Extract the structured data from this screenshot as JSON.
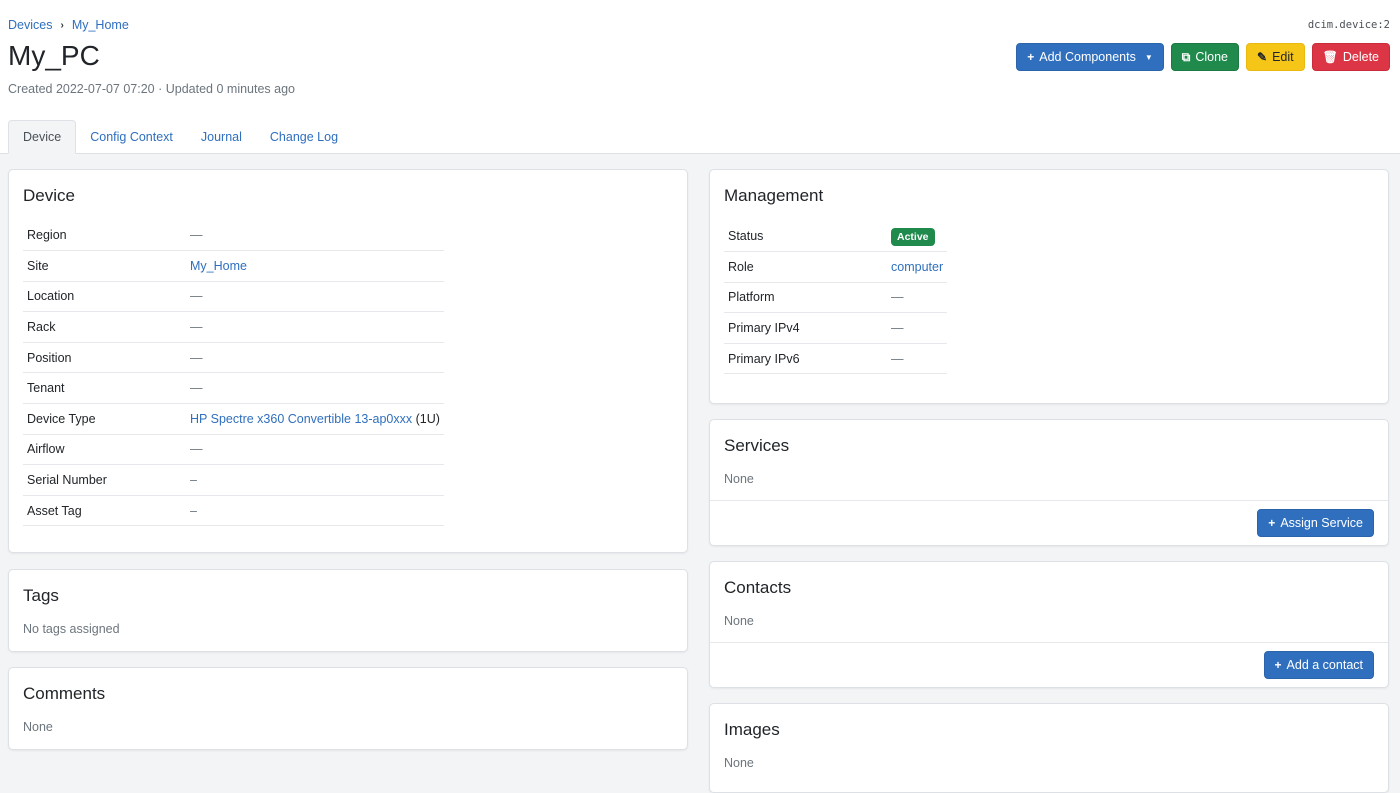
{
  "breadcrumb": {
    "root": "Devices",
    "site": "My_Home"
  },
  "object_id": "dcim.device:2",
  "title": "My_PC",
  "meta": "Created 2022-07-07 07:20 · Updated 0 minutes ago",
  "actions": {
    "add_components": "Add Components",
    "clone": "Clone",
    "edit": "Edit",
    "delete": "Delete"
  },
  "tabs": [
    "Device",
    "Config Context",
    "Journal",
    "Change Log"
  ],
  "device_card": {
    "title": "Device",
    "rows": [
      {
        "key": "Region",
        "value": "—"
      },
      {
        "key": "Site",
        "value": "My_Home"
      },
      {
        "key": "Location",
        "value": "—"
      },
      {
        "key": "Rack",
        "value": "—"
      },
      {
        "key": "Position",
        "value": "—"
      },
      {
        "key": "Tenant",
        "value": "—"
      },
      {
        "key": "Device Type",
        "value": "HP Spectre x360 Convertible 13-ap0xxx",
        "suffix": "(1U)"
      },
      {
        "key": "Airflow",
        "value": "—"
      },
      {
        "key": "Serial Number",
        "value": "–"
      },
      {
        "key": "Asset Tag",
        "value": "–"
      }
    ]
  },
  "tags_card": {
    "title": "Tags",
    "text": "No tags assigned"
  },
  "comments_card": {
    "title": "Comments",
    "text": "None"
  },
  "management_card": {
    "title": "Management",
    "rows": [
      {
        "key": "Status",
        "value": "Active"
      },
      {
        "key": "Role",
        "value": "computer"
      },
      {
        "key": "Platform",
        "value": "—"
      },
      {
        "key": "Primary IPv4",
        "value": "—"
      },
      {
        "key": "Primary IPv6",
        "value": "—"
      }
    ]
  },
  "services_card": {
    "title": "Services",
    "text": "None",
    "button": "Assign Service"
  },
  "contacts_card": {
    "title": "Contacts",
    "text": "None",
    "button": "Add a contact"
  },
  "images_card": {
    "title": "Images",
    "text": "None"
  },
  "colors": {
    "primary": "#2f6fbe",
    "success": "#1f8a4c",
    "warning": "#f5c518",
    "danger": "#dc3545"
  }
}
